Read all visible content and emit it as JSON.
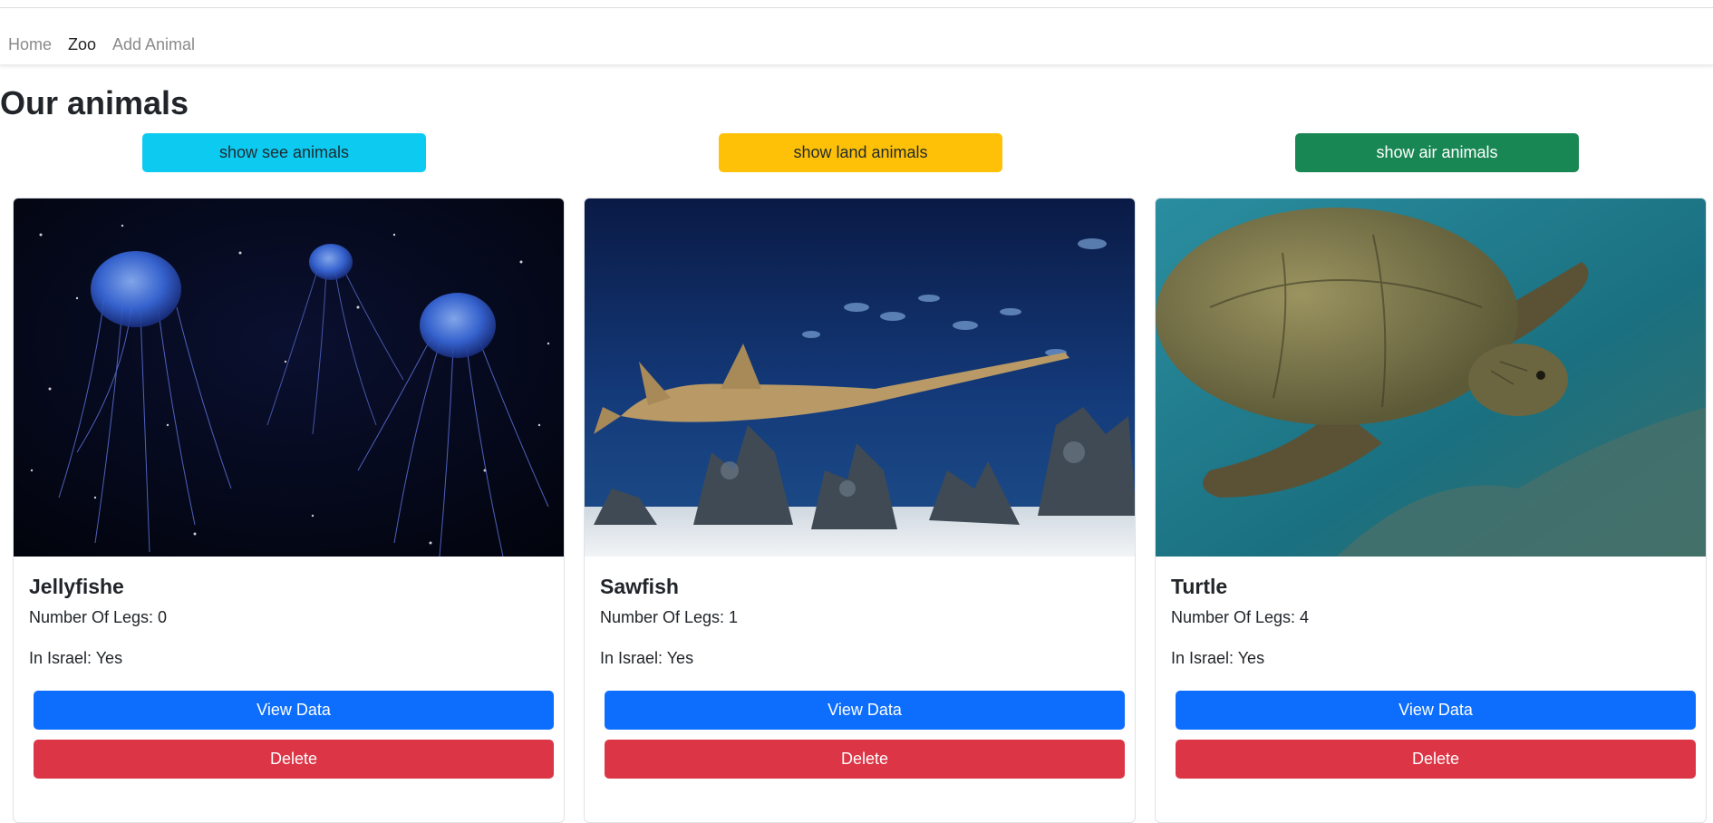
{
  "nav": {
    "items": [
      {
        "label": "Home"
      },
      {
        "label": "Zoo"
      },
      {
        "label": "Add Animal"
      }
    ]
  },
  "page": {
    "title": "Our animals"
  },
  "filters": [
    {
      "label": "show see animals",
      "color": "#0dcaf0",
      "text_color": "#1f2a30"
    },
    {
      "label": "show land animals",
      "color": "#ffc107",
      "text_color": "#1f2a30"
    },
    {
      "label": "show air animals",
      "color": "#198754",
      "text_color": "#ffffff"
    }
  ],
  "animals": [
    {
      "name": "Jellyfishe",
      "legs": "Number Of Legs: 0",
      "in_israel": "In Israel: Yes",
      "view_label": "View Data",
      "delete_label": "Delete",
      "image": "jellyfish-photo"
    },
    {
      "name": "Sawfish",
      "legs": "Number Of Legs: 1",
      "in_israel": "In Israel: Yes",
      "view_label": "View Data",
      "delete_label": "Delete",
      "image": "sawfish-photo"
    },
    {
      "name": "Turtle",
      "legs": "Number Of Legs: 4",
      "in_israel": "In Israel: Yes",
      "view_label": "View Data",
      "delete_label": "Delete",
      "image": "turtle-photo"
    }
  ],
  "colors": {
    "primary": "#0d6efd",
    "danger": "#dc3545"
  }
}
